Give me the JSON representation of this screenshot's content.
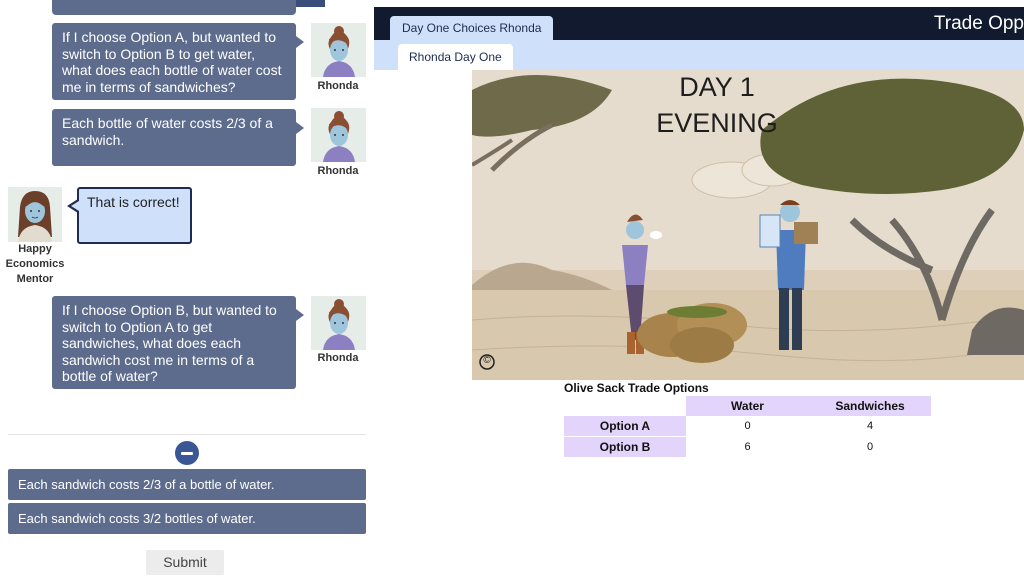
{
  "chat": {
    "q1": "If I choose Option A, but wanted to switch to Option B to get water, what does each bottle of water cost me in terms of sandwiches?",
    "a1": "Each bottle of water costs 2/3 of a sandwich.",
    "feedback": "That is correct!",
    "q2": "If I choose Option B, but wanted to switch to Option A to get sandwiches, what does each sandwich cost me in terms of a bottle of water?",
    "student_name": "Rhonda",
    "mentor_name": "Happy Economics Mentor"
  },
  "choices": [
    "Each sandwich costs 2/3 of a bottle of water.",
    "Each sandwich costs 3/2 bottles of water."
  ],
  "submit_label": "Submit",
  "header": {
    "outer_tab": "Day One Choices Rhonda",
    "inner_tab": "Rhonda Day One",
    "title": "Trade Opp"
  },
  "scene": {
    "line1": "DAY 1",
    "line2": "EVENING",
    "copyright": "©"
  },
  "table": {
    "title": "Olive Sack Trade Options",
    "columns": [
      "Water",
      "Sandwiches"
    ],
    "rows": [
      {
        "label": "Option A",
        "water": "0",
        "sandwiches": "4"
      },
      {
        "label": "Option B",
        "water": "6",
        "sandwiches": "0"
      }
    ]
  },
  "colors": {
    "bubble": "#5d6b8c",
    "header": "#111a2e",
    "tab_light": "#cfe0fb",
    "table_header": "#e2d4fb"
  }
}
